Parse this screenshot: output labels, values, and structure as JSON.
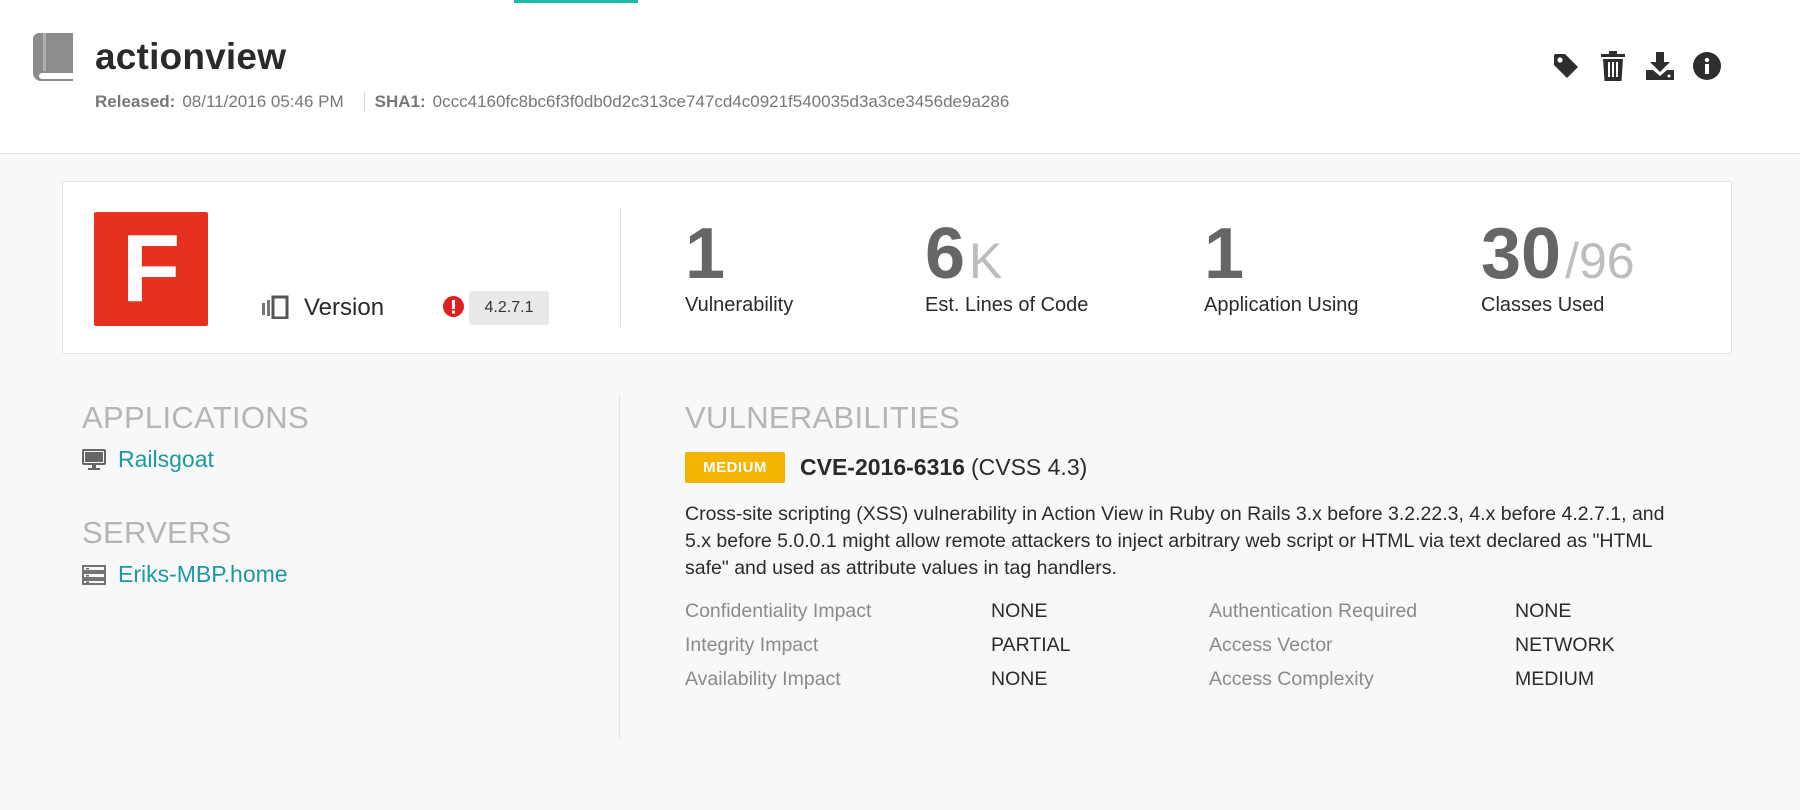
{
  "library": {
    "name": "actionview",
    "released_label": "Released:",
    "released_value": "08/11/2016 05:46 PM",
    "sha1_label": "SHA1:",
    "sha1_value": "0ccc4160fc8bc6f3f0db0d2c313ce747cd4c0921f540035d3a3ce3456de9a286"
  },
  "header_actions": [
    "tag-icon",
    "trash-icon",
    "download-icon",
    "info-icon"
  ],
  "summary": {
    "grade": "F",
    "grade_color": "#e8301f",
    "version_label": "Version",
    "version_value": "4.2.7.1",
    "stats": [
      {
        "value": "1",
        "suffix": "",
        "label": "Vulnerability"
      },
      {
        "value": "6",
        "suffix": "K",
        "label": "Est. Lines of Code"
      },
      {
        "value": "1",
        "suffix": "",
        "label": "Application Using"
      },
      {
        "value": "30",
        "suffix": "/96",
        "label": "Classes Used"
      }
    ]
  },
  "applications": {
    "title": "APPLICATIONS",
    "items": [
      {
        "name": "Railsgoat"
      }
    ]
  },
  "servers": {
    "title": "SERVERS",
    "items": [
      {
        "name": "Eriks-MBP.home"
      }
    ]
  },
  "vulnerabilities": {
    "title": "VULNERABILITIES",
    "items": [
      {
        "severity": "MEDIUM",
        "severity_color": "#f5b400",
        "cve": "CVE-2016-6316",
        "cvss": "(CVSS 4.3)",
        "description": "Cross-site scripting (XSS) vulnerability in Action View in Ruby on Rails 3.x before 3.2.22.3, 4.x before 4.2.7.1, and 5.x before 5.0.0.1 might allow remote attackers to inject arbitrary web script or HTML via text declared as \"HTML safe\" and used as attribute values in tag handlers.",
        "metrics": [
          {
            "key": "Confidentiality Impact",
            "value": "NONE"
          },
          {
            "key": "Authentication Required",
            "value": "NONE"
          },
          {
            "key": "Integrity Impact",
            "value": "PARTIAL"
          },
          {
            "key": "Access Vector",
            "value": "NETWORK"
          },
          {
            "key": "Availability Impact",
            "value": "NONE"
          },
          {
            "key": "Access Complexity",
            "value": "MEDIUM"
          }
        ]
      }
    ]
  },
  "colors": {
    "accent": "#1fb7a7",
    "link": "#1a9aa0",
    "alert": "#e02020"
  }
}
